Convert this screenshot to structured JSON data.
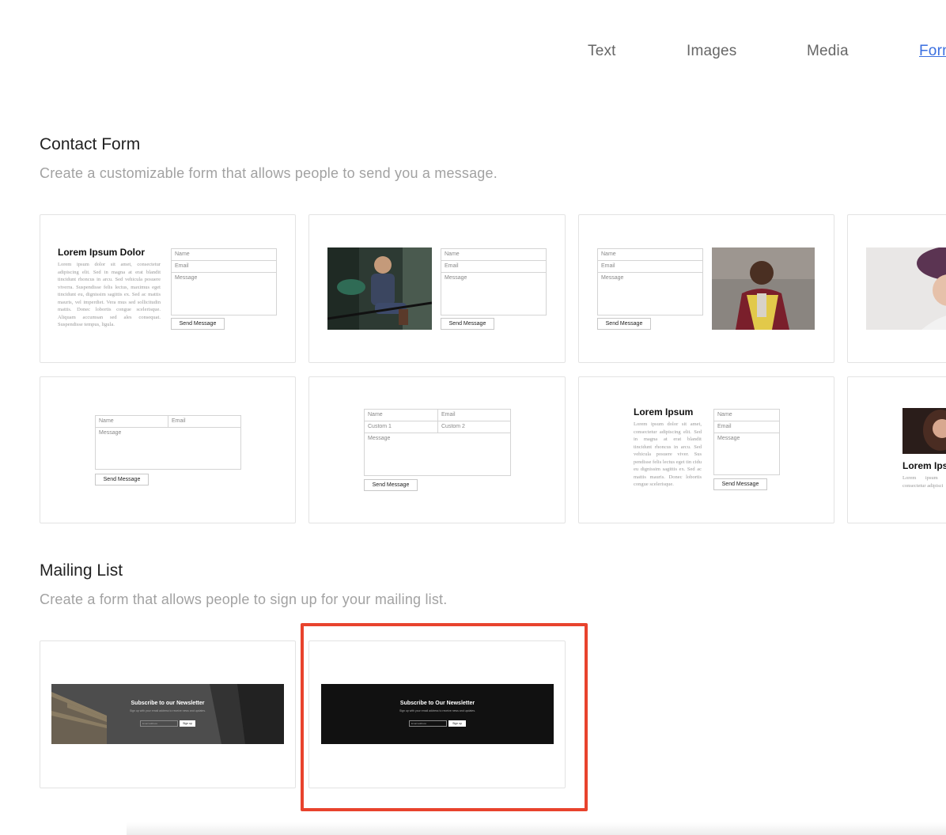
{
  "tabs": [
    {
      "label": "Text"
    },
    {
      "label": "Images"
    },
    {
      "label": "Media"
    },
    {
      "label": "Forms"
    }
  ],
  "contact": {
    "title": "Contact Form",
    "description": "Create a customizable form that allows people to send you a message."
  },
  "mailing": {
    "title": "Mailing List",
    "description": "Create a form that allows people to sign up for your mailing list."
  },
  "form": {
    "name": "Name",
    "email": "Email",
    "message": "Message",
    "custom1": "Custom 1",
    "custom2": "Custom 2",
    "send": "Send Message"
  },
  "card1": {
    "title": "Lorem Ipsum Dolor",
    "body": "Lorem ipsum dolor sit amet, consectetur adipiscing elit. Sed in magna at erat blandit tincidunt rhoncus in arcu. Sed vehicula posuere viverra. Suspendisse felis lectus, maximus eget tincidunt eu, dignissim sagittis ex. Sed ac mattis mauris, vel imperdiet. Vera mus sed sollicitudin mattis. Donec lobortis congue scelerisque. Aliquam accumsan sed ales consequat. Suspendisse tempus, ligula."
  },
  "card7": {
    "title": "Lorem Ipsum",
    "body": "Lorem ipsum dolor sit amet, consectetur adipiscing elit. Sed in magna at erat blandit tincidunt rhoncus in arcu. Sed vehicula posuere viver. Sus pendisse felis lectus eget tin cidu eu dignissim sagittis ex. Sed ac mattis mauris. Donec lobortis congue scelerisque."
  },
  "card8": {
    "title": "Lorem Ips",
    "body": "Lorem ipsum dolor consectetur adipisci"
  },
  "newsletter": {
    "title1": "Subscribe to our Newsletter",
    "title2": "Subscribe to Our Newsletter",
    "subtitle": "Sign up with your email address to receive news and updates.",
    "placeholder": "Email address",
    "button": "Sign up"
  },
  "colors": {
    "accent": "#3a6fe0",
    "highlight": "#e8432d"
  }
}
